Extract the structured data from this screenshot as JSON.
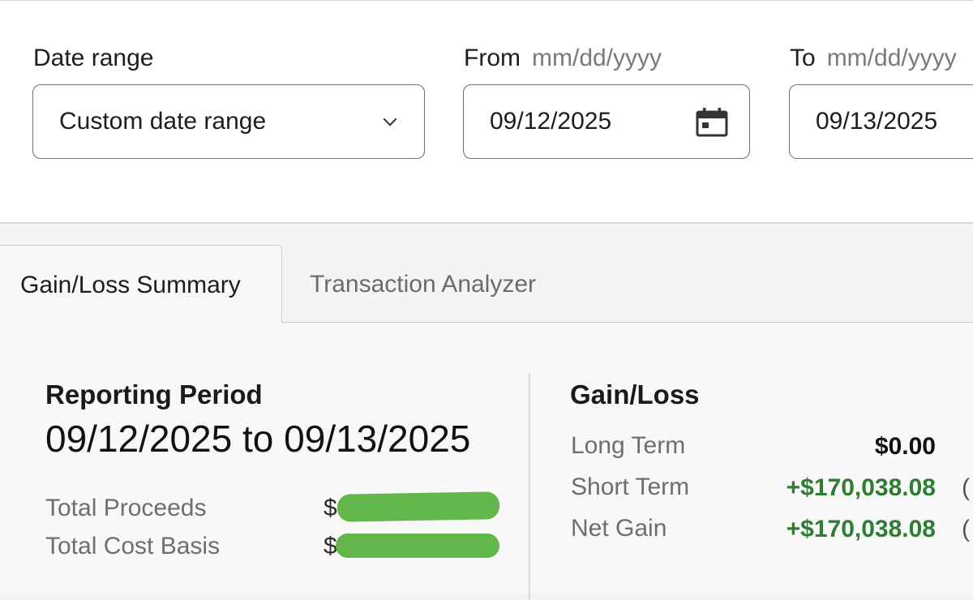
{
  "filters": {
    "date_range_label": "Date range",
    "date_range_value": "Custom date range",
    "from_label": "From",
    "from_hint": "mm/dd/yyyy",
    "from_value": "09/12/2025",
    "to_label": "To",
    "to_hint": "mm/dd/yyyy",
    "to_value": "09/13/2025"
  },
  "tabs": [
    {
      "label": "Gain/Loss Summary",
      "active": true
    },
    {
      "label": "Transaction Analyzer",
      "active": false
    }
  ],
  "reporting": {
    "title": "Reporting Period",
    "period": "09/12/2025 to 09/13/2025",
    "rows": [
      {
        "label": "Total Proceeds",
        "currency": "$",
        "value_redacted": true
      },
      {
        "label": "Total Cost Basis",
        "currency": "$",
        "value_redacted": true
      }
    ],
    "redaction_color": "#62b64a"
  },
  "gain_loss": {
    "title": "Gain/Loss",
    "rows": [
      {
        "label": "Long Term",
        "value": "$0.00",
        "color": "#111111"
      },
      {
        "label": "Short Term",
        "value": "+$170,038.08",
        "color": "#2e7d32"
      },
      {
        "label": "Net Gain",
        "value": "+$170,038.08",
        "color": "#2e7d32"
      }
    ],
    "paren_glyph": "("
  },
  "icons": {
    "dropdown": "chevron-down-icon",
    "calendar": "calendar-icon"
  }
}
